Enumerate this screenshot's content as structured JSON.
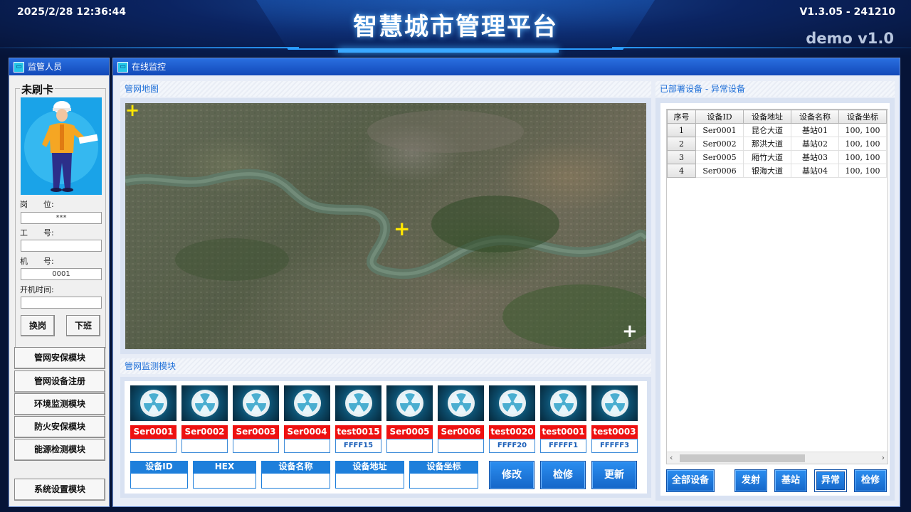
{
  "header": {
    "datetime": "2025/2/28 12:36:44",
    "title": "智慧城市管理平台",
    "version": "V1.3.05 - 241210",
    "demo": "demo v1.0"
  },
  "left_panel": {
    "title": "监管人员",
    "card_status": "未刷卡",
    "fields": {
      "post_label": "岗　　位:",
      "post_value": "***",
      "job_no_label": "工　　号:",
      "job_no_value": "",
      "machine_no_label": "机　　号:",
      "machine_no_value": "0001",
      "boot_time_label": "开机时间:",
      "boot_time_value": ""
    },
    "buttons": {
      "switch_post": "换岗",
      "off_duty": "下班"
    },
    "modules": [
      "管网安保模块",
      "管网设备注册",
      "环境监测模块",
      "防火安保模块",
      "能源检测模块"
    ],
    "settings": "系统设置模块"
  },
  "main_panel": {
    "title": "在线监控",
    "map_title": "管网地图",
    "monitor_title": "管网监测模块",
    "devices": [
      {
        "id": "Ser0001",
        "hex": ""
      },
      {
        "id": "Ser0002",
        "hex": ""
      },
      {
        "id": "Ser0003",
        "hex": ""
      },
      {
        "id": "Ser0004",
        "hex": ""
      },
      {
        "id": "test0015",
        "hex": "FFFF15"
      },
      {
        "id": "Ser0005",
        "hex": ""
      },
      {
        "id": "Ser0006",
        "hex": ""
      },
      {
        "id": "test0020",
        "hex": "FFFF20"
      },
      {
        "id": "test0001",
        "hex": "FFFFF1"
      },
      {
        "id": "test0003",
        "hex": "FFFFF3"
      }
    ],
    "form": {
      "device_id": "设备ID",
      "hex": "HEX",
      "device_name": "设备名称",
      "device_address": "设备地址",
      "device_coords": "设备坐标"
    },
    "actions": {
      "modify": "修改",
      "repair": "检修",
      "update": "更新"
    }
  },
  "right_panel": {
    "title": "已部署设备 - 异常设备",
    "table": {
      "headers": [
        "序号",
        "设备ID",
        "设备地址",
        "设备名称",
        "设备坐标"
      ],
      "rows": [
        [
          "1",
          "Ser0001",
          "昆仑大道",
          "基站01",
          "100, 100"
        ],
        [
          "2",
          "Ser0002",
          "那洪大道",
          "基站02",
          "100, 100"
        ],
        [
          "3",
          "Ser0005",
          "厢竹大道",
          "基站03",
          "100, 100"
        ],
        [
          "4",
          "Ser0006",
          "银海大道",
          "基站04",
          "100, 100"
        ]
      ]
    },
    "buttons": {
      "all_devices": "全部设备",
      "emit": "发射",
      "base_station": "基站",
      "abnormal": "异常",
      "repair": "检修"
    }
  },
  "colors": {
    "accent": "#1e7fdb",
    "header_bg": "#061437",
    "alert_red": "#ee1111",
    "marker_yellow": "#ffe600"
  }
}
